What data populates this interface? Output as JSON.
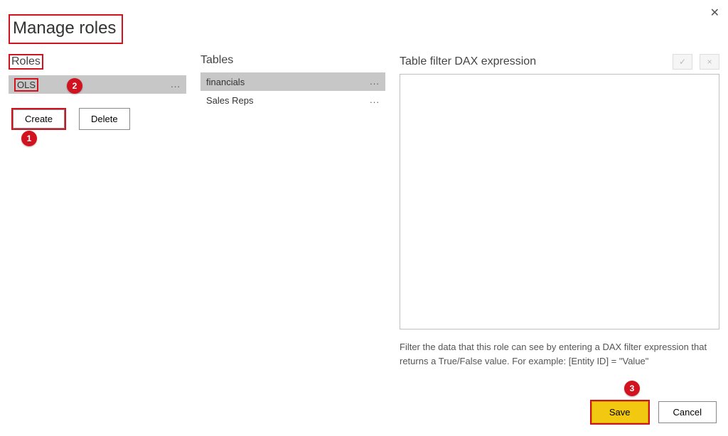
{
  "dialog": {
    "title": "Manage roles"
  },
  "roles": {
    "header": "Roles",
    "items": [
      {
        "name": "OLS"
      }
    ],
    "create_label": "Create",
    "delete_label": "Delete"
  },
  "tables": {
    "header": "Tables",
    "items": [
      {
        "name": "financials"
      },
      {
        "name": "Sales Reps"
      }
    ]
  },
  "expression": {
    "header": "Table filter DAX expression",
    "value": "",
    "hint": "Filter the data that this role can see by entering a DAX filter expression that returns a True/False value. For example: [Entity ID] = \"Value\"",
    "confirm_icon": "✓",
    "revert_icon": "×"
  },
  "footer": {
    "save_label": "Save",
    "cancel_label": "Cancel"
  },
  "annotations": {
    "badge1": "1",
    "badge2": "2",
    "badge3": "3"
  }
}
